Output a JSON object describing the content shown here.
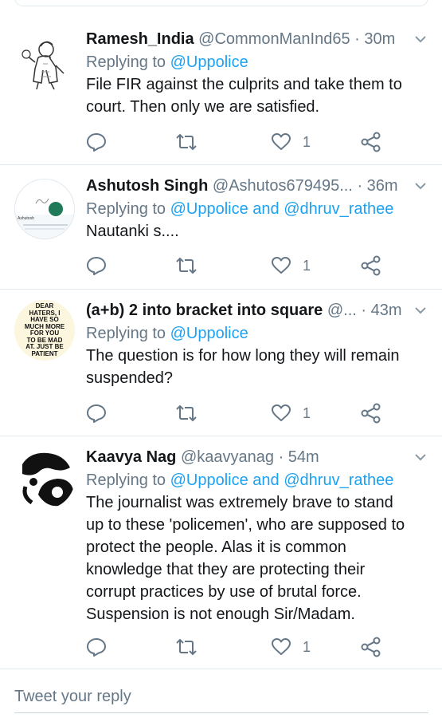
{
  "tweets": [
    {
      "name": "Ramesh_India",
      "handle": "@CommonManInd65",
      "time": "· 30m",
      "reply_prefix": "Replying to ",
      "mentions": [
        "@Uppolice"
      ],
      "joiner": "",
      "text_lines": [
        "File FIR against the culprits and take them to",
        "court. Then only we are satisfied."
      ],
      "likes": "1"
    },
    {
      "name": "Ashutosh Singh",
      "handle": "@Ashutos679495...",
      "time": "· 36m",
      "reply_prefix": "Replying to ",
      "mentions": [
        "@Uppolice",
        "@dhruv_rathee"
      ],
      "joiner": " and ",
      "text_lines": [
        "Nautanki s...."
      ],
      "likes": "1",
      "avatar_label": "Ashutosh"
    },
    {
      "name": "(a+b) 2 into bracket into square",
      "handle": "@...",
      "time": "· 43m",
      "reply_prefix": "Replying to ",
      "mentions": [
        "@Uppolice"
      ],
      "joiner": "",
      "text_lines": [
        "The question is for how long they will remain",
        "suspended?"
      ],
      "likes": "1",
      "avatar_text": [
        "DEAR",
        "HATERS, I",
        "HAVE SO",
        "MUCH MORE",
        "FOR YOU",
        "TO BE MAD",
        "AT. JUST BE",
        "PATIENT"
      ]
    },
    {
      "name": "Kaavya Nag",
      "handle": "@kaavyanag",
      "time": "· 54m",
      "reply_prefix": "Replying to ",
      "mentions": [
        "@Uppolice",
        "@dhruv_rathee"
      ],
      "joiner": " and ",
      "text_lines": [
        "The journalist was extremely brave to stand",
        "up to these 'policemen', who are supposed to",
        "protect the people. Alas it is common",
        "knowledge that they are protecting their",
        "corrupt practices by use of brutal force.",
        "Suspension is not enough Sir/Madam."
      ],
      "likes": "1"
    }
  ],
  "reply_placeholder": "Tweet your reply",
  "colors": {
    "accent": "#1da1f2",
    "muted": "#657786",
    "text": "#14171a",
    "divider": "#e1e8ed"
  },
  "icons": [
    "reply-icon",
    "retweet-icon",
    "like-icon",
    "share-icon",
    "chevron-down-icon"
  ]
}
